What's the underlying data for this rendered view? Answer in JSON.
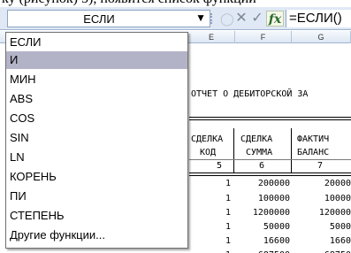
{
  "top_strip": {
    "text": "ку (рисунок) 5), появится   список функций"
  },
  "formula_bar": {
    "name_box_value": "ЕСЛИ",
    "name_box_arrow": "▼",
    "cancel_symbol": "✕",
    "enter_symbol": "✓",
    "insert_function_label": "fx",
    "formula_value": "=ЕСЛИ()"
  },
  "columns": [
    "E",
    "F",
    "G"
  ],
  "sheet": {
    "report_title": "ОТЧЕТ О ДЕБИТОРСКОЙ ЗА",
    "headers": {
      "e_line1": "СДЕЛКА",
      "e_line2": "КОД",
      "f_line1": "СДЕЛКА",
      "f_line2": "СУММА",
      "g_line1": "ФАКТИЧ",
      "g_line2": "БАЛАНС"
    },
    "col_numbers": {
      "e": "5",
      "f": "6",
      "g": "7"
    },
    "rows": [
      {
        "e": "1",
        "f": "200000",
        "g": "20000"
      },
      {
        "e": "1",
        "f": "100000",
        "g": "10000"
      },
      {
        "e": "1",
        "f": "1200000",
        "g": "120000"
      },
      {
        "e": "1",
        "f": "50000",
        "g": "5000"
      },
      {
        "e": "1",
        "f": "16600",
        "g": "1660"
      },
      {
        "e": "1",
        "f": "687500",
        "g": "68750"
      }
    ]
  },
  "function_list": {
    "selected_index": 1,
    "items": [
      "ЕСЛИ",
      "И",
      "МИН",
      "ABS",
      "COS",
      "SIN",
      "LN",
      "КОРЕНЬ",
      "ПИ",
      "СТЕПЕНЬ",
      "Другие функции..."
    ]
  },
  "colors": {
    "formula_bar_bg": "#dfe8f4",
    "selected_item": "#b3b3c8",
    "fx_green": "#2b6a2b"
  }
}
